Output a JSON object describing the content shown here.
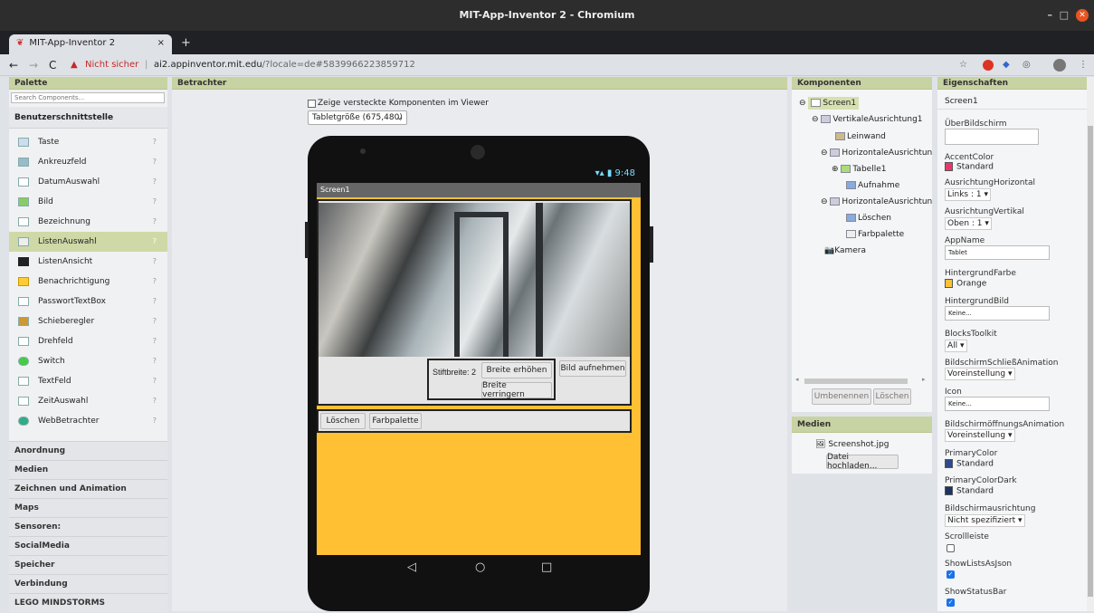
{
  "window": {
    "title": "MIT-App-Inventor 2 - Chromium"
  },
  "tab": {
    "label": "MIT-App-Inventor 2",
    "close": "×",
    "new_tab": "+"
  },
  "address": {
    "warning": "Nicht sicher",
    "url_host": "ai2.appinventor.mit.edu",
    "url_path": "/?locale=de#5839966223859712"
  },
  "palette": {
    "header": "Palette",
    "search_placeholder": "Search Components...",
    "group_open": "Benutzerschnittstelle",
    "items": [
      {
        "label": "Taste"
      },
      {
        "label": "Ankreuzfeld"
      },
      {
        "label": "DatumAuswahl"
      },
      {
        "label": "Bild"
      },
      {
        "label": "Bezeichnung"
      },
      {
        "label": "ListenAuswahl"
      },
      {
        "label": "ListenAnsicht"
      },
      {
        "label": "Benachrichtigung"
      },
      {
        "label": "PasswortTextBox"
      },
      {
        "label": "Schieberegler"
      },
      {
        "label": "Drehfeld"
      },
      {
        "label": "Switch"
      },
      {
        "label": "TextFeld"
      },
      {
        "label": "ZeitAuswahl"
      },
      {
        "label": "WebBetrachter"
      }
    ],
    "categories": [
      "Anordnung",
      "Medien",
      "Zeichnen und Animation",
      "Maps",
      "Sensoren:",
      "SocialMedia",
      "Speicher",
      "Verbindung",
      "LEGO MINDSTORMS"
    ]
  },
  "viewer": {
    "header": "Betrachter",
    "hidden_checkbox_label": "Zeige versteckte Komponenten im Viewer",
    "size_select": "Tabletgröße (675,480)",
    "phone": {
      "time": "9:48",
      "screen_title": "Screen1",
      "stiftbreite_label": "Stiftbreite:",
      "stiftbreite_value": "2",
      "btn_breite_erhoehen": "Breite erhöhen",
      "btn_breite_verringern": "Breite verringern",
      "btn_bild_aufnehmen": "Bild aufnehmen",
      "btn_loeschen": "Löschen",
      "btn_farbpalette": "Farbpalette"
    }
  },
  "components": {
    "header": "Komponenten",
    "tree": [
      "Screen1",
      "VertikaleAusrichtung1",
      "Leinwand",
      "HorizontaleAusrichtun",
      "Tabelle1",
      "Aufnahme",
      "HorizontaleAusrichtun",
      "Löschen",
      "Farbpalette",
      "Kamera"
    ],
    "rename_button": "Umbenennen",
    "delete_button": "Löschen"
  },
  "media": {
    "header": "Medien",
    "file": "Screenshot.jpg",
    "upload_button": "Datei hochladen..."
  },
  "properties": {
    "header": "Eigenschaften",
    "component": "Screen1",
    "ueberbildschirm": "ÜberBildschirm",
    "accent_label": "AccentColor",
    "accent_value": "Standard",
    "align_h_label": "AusrichtungHorizontal",
    "align_h_value": "Links : 1",
    "align_v_label": "AusrichtungVertikal",
    "align_v_value": "Oben : 1",
    "appname_label": "AppName",
    "appname_value": "Tablet",
    "bgcolor_label": "HintergrundFarbe",
    "bgcolor_value": "Orange",
    "bgimage_label": "HintergrundBild",
    "bgimage_value": "Keine...",
    "blocks_label": "BlocksToolkit",
    "blocks_value": "All",
    "close_anim_label": "BildschirmSchließAnimation",
    "close_anim_value": "Voreinstellung",
    "icon_label": "Icon",
    "icon_value": "Keine...",
    "open_anim_label": "BildschirmöffnungsAnimation",
    "open_anim_value": "Voreinstellung",
    "primary_label": "PrimaryColor",
    "primary_value": "Standard",
    "primary_dark_label": "PrimaryColorDark",
    "primary_dark_value": "Standard",
    "orientation_label": "Bildschirmausrichtung",
    "orientation_value": "Nicht spezifiziert",
    "scroll_label": "Scrollleiste",
    "show_lists_label": "ShowListsAsJson",
    "show_status_label": "ShowStatusBar"
  },
  "colors": {
    "accent": "#e8376b",
    "orange": "#ffc033",
    "primary": "#2c4a8c",
    "panel_header": "#c8d3a3"
  }
}
